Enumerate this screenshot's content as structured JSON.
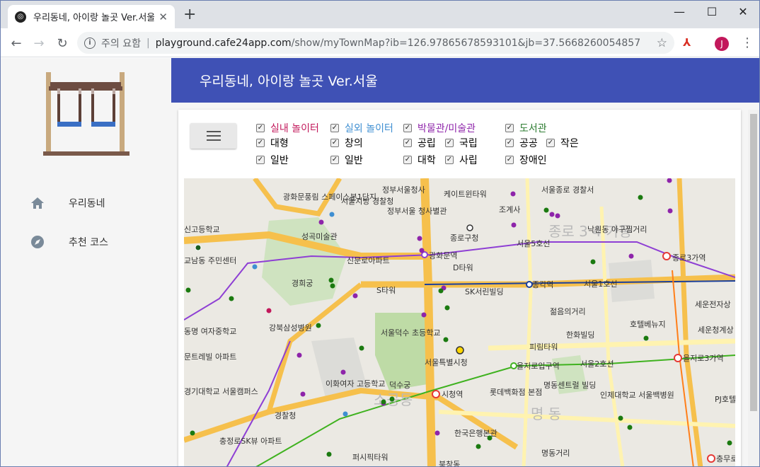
{
  "browser": {
    "tab_title": "우리동네, 아이랑 놀곳 Ver.서울",
    "new_tab_symbol": "+",
    "url_warning": "주의 요함",
    "url_host": "playground.cafe24app.com",
    "url_path": "/show/myTownMap?ib=126.97865678593101&jb=37.5668260054857",
    "profile_initial": "J"
  },
  "app": {
    "title": "우리동네, 아이랑 놀곳 Ver.서울",
    "menu": [
      {
        "label": "우리동네",
        "icon": "home-icon"
      },
      {
        "label": "추천 코스",
        "icon": "compass-icon"
      }
    ]
  },
  "filters": {
    "groups": [
      {
        "label": "실내 놀이터",
        "color": "#c2185b",
        "checked": true
      },
      {
        "label": "실외 놀이터",
        "color": "#3f8fd2",
        "checked": true
      },
      {
        "label": "박물관/미술관",
        "color": "#8e24aa",
        "checked": true
      },
      {
        "label": "도서관",
        "color": "#2e7d32",
        "checked": true
      }
    ],
    "options": [
      "대형",
      "일반",
      "창의",
      "일반",
      "공립",
      "대학",
      "국립",
      "사립",
      "공공",
      "장애인",
      "작은"
    ]
  },
  "map": {
    "labels": [
      "광화문풍림 스페이스본1단지",
      "서울지방 경찰청",
      "정부서울청사",
      "케이트윈타워",
      "서울종로 경찰서",
      "정부서울 청사별관",
      "조계사",
      "신고등학교",
      "성곡미술관",
      "종로구청",
      "낙원동 아구찜거리",
      "교남동 주민센터",
      "광화문역",
      "종로3가역",
      "신문로아파트",
      "D타워",
      "경희궁",
      "S타워",
      "SK서린빌딩",
      "종각역",
      "세운전자상",
      "동명 여자중학교",
      "강북삼성병원",
      "서울덕수 초등학교",
      "젊음의거리",
      "호텔베뉴지",
      "세운청계상",
      "한화빌딩",
      "서울특별시청",
      "피림타워",
      "을지로입구역",
      "을지로3가역",
      "문트레빌 아파트",
      "이화여자 고등학교",
      "덕수궁",
      "시청역",
      "롯데백화점 본점",
      "명동센트럴 빌딩",
      "인제대학교 서울백병원",
      "경기대학교 서울캠퍼스",
      "경찰청",
      "한국은행본관",
      "충정로SK뷰 아파트",
      "퍼시픽타워",
      "명동거리",
      "충무로",
      "PJ호텔",
      "북창동"
    ],
    "districts": [
      "종로 3 4 가동",
      "명 동",
      "소공동"
    ],
    "subway_lines": [
      "서울5호선",
      "서울1호선",
      "서울2호선"
    ]
  }
}
